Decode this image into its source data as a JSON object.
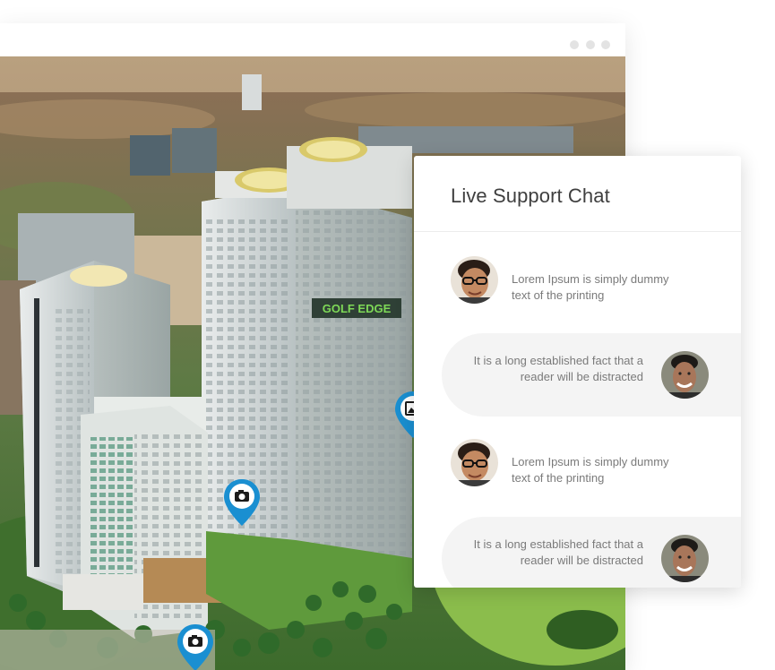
{
  "window": {
    "controls": [
      "dot",
      "dot",
      "dot"
    ]
  },
  "scene": {
    "building_sign": "GOLF EDGE",
    "pins": [
      {
        "icon": "camera-icon"
      },
      {
        "icon": "camera-icon"
      },
      {
        "icon": "gallery-icon"
      }
    ]
  },
  "chat": {
    "title": "Live Support Chat",
    "messages": [
      {
        "side": "incoming",
        "avatar": "avatar-man-glasses",
        "text": "Lorem Ipsum is simply dummy text of the printing"
      },
      {
        "side": "outgoing",
        "avatar": "avatar-man-smiling",
        "text": "It is a long established fact that a reader will be distracted"
      },
      {
        "side": "incoming",
        "avatar": "avatar-man-glasses",
        "text": "Lorem Ipsum is simply dummy text of the printing"
      },
      {
        "side": "outgoing",
        "avatar": "avatar-man-smiling",
        "text": "It is a long established fact that a reader will be distracted"
      }
    ]
  },
  "colors": {
    "pin_blue": "#1a8fd1",
    "chat_bubble": "#f4f4f4",
    "sign_green": "#7ed957"
  }
}
